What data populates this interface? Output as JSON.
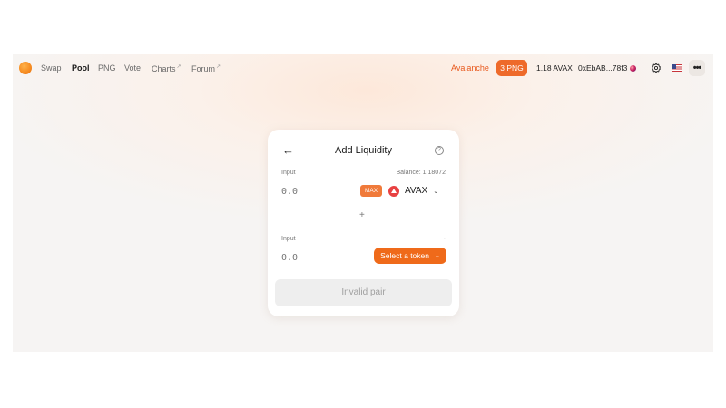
{
  "nav": {
    "links": [
      {
        "label": "Swap"
      },
      {
        "label": "Pool"
      },
      {
        "label": "PNG"
      },
      {
        "label": "Vote"
      },
      {
        "label": "Charts",
        "suffix": "↗"
      },
      {
        "label": "Forum",
        "suffix": "↗"
      }
    ],
    "active": "Pool",
    "network": "Avalanche",
    "png_badge": "3 PNG",
    "balance": "1.18 AVAX",
    "address": "0xEbAB...78f3",
    "settings_icon": "gear-icon",
    "language_icon": "us-flag-icon",
    "more_icon": "more-icon",
    "more_glyph": "•••"
  },
  "card": {
    "title": "Add Liquidity",
    "back_glyph": "←",
    "help_glyph": "?",
    "input_a": {
      "label": "Input",
      "balance": "Balance: 1.18072",
      "placeholder": "0.0",
      "max_label": "MAX",
      "token": "AVAX",
      "chevron": "⌄"
    },
    "plus_glyph": "+",
    "input_b": {
      "label": "Input",
      "balance": "-",
      "placeholder": "0.0",
      "select_label": "Select a token",
      "chevron": "⌄"
    },
    "submit_label": "Invalid pair"
  },
  "colors": {
    "accent": "#ef6a1a",
    "network": "#e8581c",
    "avax": "#e84142"
  }
}
